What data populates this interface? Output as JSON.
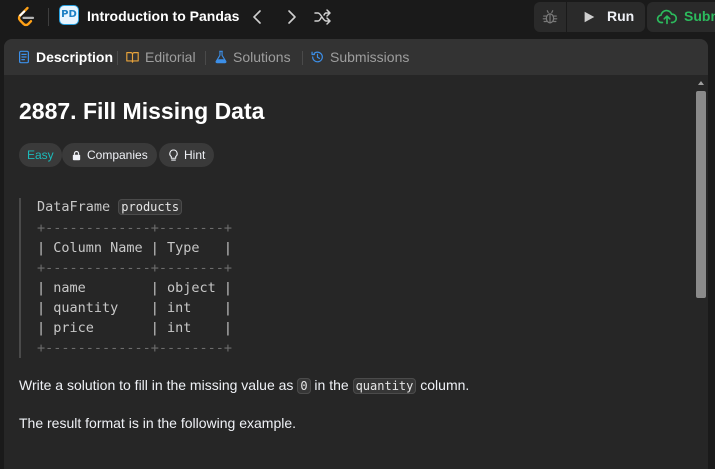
{
  "topbar": {
    "study_plan_badge": "PD",
    "study_plan_title": "Introduction to Pandas",
    "run_label": "Run",
    "submit_label": "Submit"
  },
  "tabs": [
    {
      "label": "Description",
      "icon": "description-icon",
      "active": true
    },
    {
      "label": "Editorial",
      "icon": "book-icon",
      "active": false
    },
    {
      "label": "Solutions",
      "icon": "flask-icon",
      "active": false
    },
    {
      "label": "Submissions",
      "icon": "history-icon",
      "active": false
    }
  ],
  "problem": {
    "title": "2887. Fill Missing Data",
    "difficulty": "Easy",
    "companies_label": "Companies",
    "hint_label": "Hint",
    "schema_prefix": "DataFrame ",
    "schema_name": "products",
    "schema_lines": [
      "+-------------+--------+",
      "| Column Name | Type   |",
      "+-------------+--------+",
      "| name        | object |",
      "| quantity    | int    |",
      "| price       | int    |",
      "+-------------+--------+"
    ],
    "para1_before": "Write a solution to fill in the missing value as ",
    "para1_value": "0",
    "para1_middle": " in the ",
    "para1_column": "quantity",
    "para1_after": " column.",
    "para2": "The result format is in the following example."
  },
  "colors": {
    "accent_easy": "#1cbaba",
    "submit_green": "#2cbb5d",
    "logo_orange": "#ffa116",
    "tab_icon_blue": "#3c8fe8"
  }
}
